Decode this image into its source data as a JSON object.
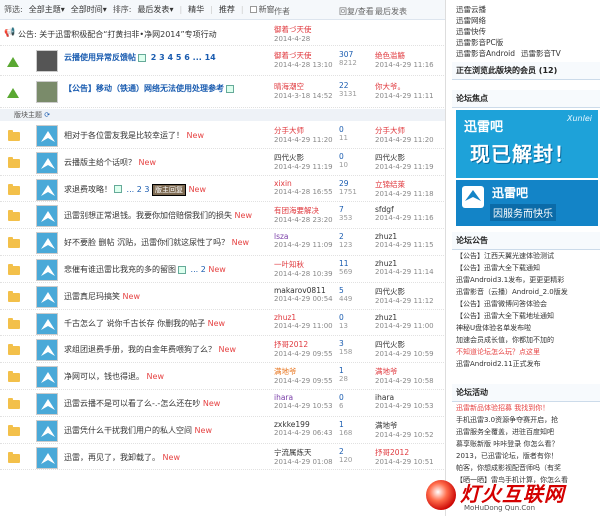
{
  "filter": {
    "label": "筛选:",
    "all_topics": "全部主题",
    "all_time": "全部时间",
    "sort_label": "排序:",
    "sort_value": "最后发表",
    "digest": "精华",
    "recommend": "推荐",
    "new_window": "新窗"
  },
  "columns": {
    "author": "作者",
    "replies_views": "回复/查看",
    "last_post": "最后发表"
  },
  "announcement": {
    "label": "公告:",
    "text": "关于迅雷积极配合“打黄扫非•净网2014”专项行动",
    "author": "御着づ天使",
    "date": "2014-4-28"
  },
  "sticky": [
    {
      "title": "云播使用异常反馈帖",
      "pages": [
        "2",
        "3",
        "4",
        "5",
        "6",
        "..."
      ],
      "last_page": "14",
      "author": "御着づ天使",
      "author_date": "2014-4-28 13:10",
      "replies": "307",
      "views": "8212",
      "last_user": "绝色滥觞",
      "last_date": "2014-4-29 11:16"
    },
    {
      "title": "【公告】移动（铁通）网络无法使用处理参考",
      "author": "晴海潮空",
      "author_date": "2014-3-18 14:52",
      "replies": "22",
      "views": "3131",
      "last_user": "你大爷。",
      "last_date": "2014-4-29 11:11"
    }
  ],
  "subhead": "版块主题",
  "threads": [
    {
      "title": "相对于各位雷友我是比较幸运了！",
      "new": "New",
      "author": "分手大师",
      "author_date": "2014-4-29 11:20",
      "replies": "0",
      "views": "11",
      "last_user": "分手大师",
      "last_date": "2014-4-29 11:20"
    },
    {
      "title": "云播版主给个话呗？",
      "new": "New",
      "author": "四代火影",
      "author_date": "2014-4-29 11:19",
      "replies": "0",
      "views": "10",
      "last_user": "四代火影",
      "last_date": "2014-4-29 11:19"
    },
    {
      "title": "求退费攻略！",
      "pages": [
        "...",
        "2",
        "3"
      ],
      "new": "New",
      "badge": "版主回复",
      "author": "xixin",
      "author_date": "2014-4-28 16:55",
      "replies": "29",
      "views": "1751",
      "last_user": "立锦结萊",
      "last_date": "2014-4-29 11:18"
    },
    {
      "title": "迅雷别想正常退钱。我要你加倍赔偿我们的损失",
      "new": "New",
      "author": "有团海要解决",
      "author_date": "2014-4-28 23:20",
      "replies": "7",
      "views": "353",
      "last_user": "sfdgf",
      "last_date": "2014-4-29 11:16"
    },
    {
      "title": "好不要脸 删帖 沉贴，迅雷你们就这尿性了吗？",
      "new": "New",
      "author": "lsza",
      "author_date": "2014-4-29 11:09",
      "replies": "2",
      "views": "123",
      "last_user": "zhuz1",
      "last_date": "2014-4-29 11:15"
    },
    {
      "title": "悲催有谁迅雷比我充的多的留图",
      "pages": [
        "...",
        "2"
      ],
      "new": "New",
      "author": "一叶知秋",
      "author_date": "2014-4-28 10:39",
      "replies": "11",
      "views": "569",
      "last_user": "zhuz1",
      "last_date": "2014-4-29 11:14"
    },
    {
      "title": "迅雷真尼玛搞笑",
      "new": "New",
      "author": "makarov0811",
      "author_date": "2014-4-29 00:54",
      "replies": "5",
      "views": "449",
      "last_user": "四代火影",
      "last_date": "2014-4-29 11:12"
    },
    {
      "title": "千古怎么了 说你千古长存 你删我的帖子",
      "new": "New",
      "author": "zhuz1",
      "author_date": "2014-4-29 11:00",
      "replies": "0",
      "views": "13",
      "last_user": "zhuz1",
      "last_date": "2014-4-29 11:00"
    },
    {
      "title": "求组团退费手册，我的白金年费喂狗了么？",
      "new": "New",
      "author": "抒哥2012",
      "author_date": "2014-4-29 09:55",
      "replies": "3",
      "views": "158",
      "last_user": "四代火影",
      "last_date": "2014-4-29 10:59"
    },
    {
      "title": "净网可以，钱也得退。",
      "new": "New",
      "author": "满地爷",
      "author_date": "2014-4-29 09:55",
      "replies": "1",
      "views": "28",
      "last_user": "满地爷",
      "last_date": "2014-4-29 10:58"
    },
    {
      "title": "迅雷云播不是可以看了么-.-怎么还在吵",
      "new": "New",
      "author": "ihara",
      "author_date": "2014-4-29 10:53",
      "replies": "0",
      "views": "6",
      "last_user": "ihara",
      "last_date": "2014-4-29 10:53"
    },
    {
      "title": "迅雷凭什么干扰我们用户的私人空间",
      "new": "New",
      "author": "zxkke199",
      "author_date": "2014-4-29 06:43",
      "replies": "1",
      "views": "168",
      "last_user": "满地爷",
      "last_date": "2014-4-29 10:52"
    },
    {
      "title": "迅雷，再见了，我卸载了。",
      "new": "New",
      "author": "宁流属炼天",
      "author_date": "2014-4-29 01:08",
      "replies": "2",
      "views": "120",
      "last_user": "抒哥2012",
      "last_date": "2014-4-29 10:51"
    }
  ],
  "right": {
    "top_links": [
      "迅雷云播",
      "迅雷网络",
      "迅雷快传",
      "迅雷影音PC版",
      "迅雷看看",
      "迅雷影音Android",
      "迅雷影音TV"
    ],
    "online": "正在浏览此版块的会员 (12)",
    "focus_title": "论坛焦点",
    "banner1_top": "迅雷吧",
    "banner1_main": "现已解封！",
    "banner1_brand": "Xunlei",
    "banner2_main": "迅雷吧",
    "banner2_sub": "因服务而快乐",
    "notice_title": "论坛公告",
    "notices": [
      "【公告】江西天翼光速体验测试",
      "【公告】迅雷大全下载通知",
      "迅雷Android3.1发布，更更更精彩",
      "迅雷影音（云播）Android_2.0版发",
      "【公告】迅雷微博问答体验会",
      "【公告】迅雷大全下载地址通知",
      "神秘U盘体验名单发布啦",
      "加速会员成长值，你都加不加的",
      "不知道论坛怎么玩？点这里",
      "迅雷Android2.11正式发布"
    ],
    "activity_title": "论坛活动",
    "activities": [
      "迅雷新品体验招募 我找到你！",
      "手机迅雷3.0资源争夺赛开启，抢",
      "迅雷服务全覆盖，进驻百度知吧",
      "慕享账新版 咔咔登录 你怎么看？",
      "2013，已迅雷论坛，版者有你！",
      "帕客，你想成影视配音师吗（有奖",
      "【晒一晒】雷鸟手机计算，你怎么看"
    ]
  },
  "logo": {
    "text": "灯火互联网",
    "sub": "MoHuDong Qun.Con"
  },
  "colors": {
    "link": "#1a5cb0",
    "accent_red": "#e0393e",
    "new": "#e64444",
    "folder": "#f3c04a"
  }
}
